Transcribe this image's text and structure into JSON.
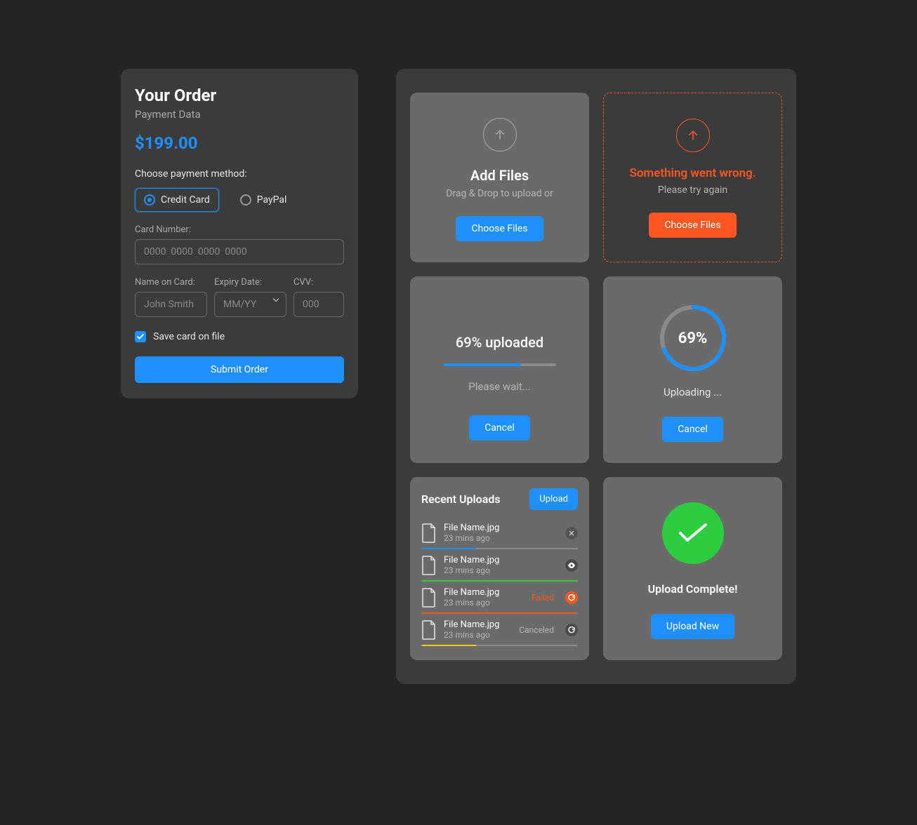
{
  "order": {
    "title": "Your Order",
    "subtitle": "Payment Data",
    "price": "$199.00",
    "choose_label": "Choose payment method:",
    "methods": {
      "credit_card": "Credit Card",
      "paypal": "PayPal"
    },
    "card_number_label": "Card Number:",
    "card_number_placeholder": "0000  0000  0000  0000",
    "name_label": "Name on Card:",
    "name_placeholder": "John Smith",
    "expiry_label": "Expiry Date:",
    "expiry_placeholder": "MM/YY",
    "cvv_label": "CVV:",
    "cvv_placeholder": "000",
    "save_label": "Save card on file",
    "submit_label": "Submit Order"
  },
  "upload": {
    "add_title": "Add Files",
    "add_sub": "Drag & Drop to upload or",
    "choose_label": "Choose Files",
    "error_title": "Something went wrong.",
    "error_sub": "Please try again",
    "progress_pct": 69,
    "progress_title": "69% uploaded",
    "wait_text": "Please wait...",
    "cancel_label": "Cancel",
    "ring_pct": "69%",
    "ring_label": "Uploading ...",
    "success_title": "Upload Complete!",
    "upload_new_label": "Upload New"
  },
  "recent": {
    "title": "Recent Uploads",
    "upload_label": "Upload",
    "items": [
      {
        "name": "File Name.jpg",
        "time": "23 mins ago",
        "status": "",
        "action": "close",
        "bar_pct": 35,
        "bar_color": "#1e90ff"
      },
      {
        "name": "File Name.jpg",
        "time": "23 mins ago",
        "status": "",
        "action": "view",
        "bar_pct": 100,
        "bar_color": "#2ecc40"
      },
      {
        "name": "File Name.jpg",
        "time": "23 mins ago",
        "status": "Failed",
        "action": "retry-orange",
        "bar_pct": 100,
        "bar_color": "#ff5722"
      },
      {
        "name": "File Name.jpg",
        "time": "23 mins ago",
        "status": "Canceled",
        "action": "retry",
        "bar_pct": 35,
        "bar_color": "#f1c40f"
      }
    ]
  },
  "colors": {
    "blue": "#1e90ff",
    "orange": "#ff5722",
    "green": "#2ecc40",
    "yellow": "#f1c40f"
  }
}
